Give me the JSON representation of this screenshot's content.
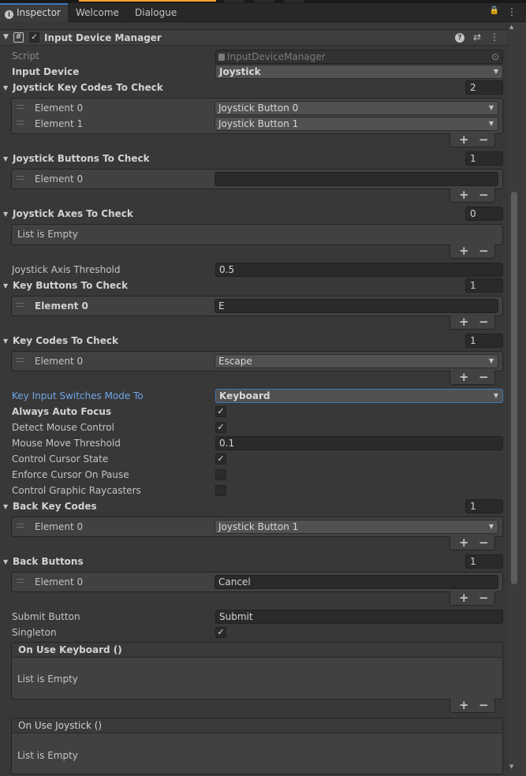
{
  "tabs": [
    {
      "label": "Inspector",
      "active": true,
      "icon": "info-icon"
    },
    {
      "label": "Welcome",
      "active": false
    },
    {
      "label": "Dialogue",
      "active": false
    }
  ],
  "component": {
    "title": "Input Device Manager",
    "enabled": true,
    "icons": [
      "help-icon",
      "preset-icon",
      "more-icon"
    ]
  },
  "script": {
    "label": "Script",
    "value": "InputDeviceManager"
  },
  "input_device": {
    "label": "Input Device",
    "value": "Joystick"
  },
  "joystick_key_codes": {
    "label": "Joystick Key Codes To Check",
    "count": "2",
    "elements": [
      {
        "label": "Element 0",
        "value": "Joystick Button 0"
      },
      {
        "label": "Element 1",
        "value": "Joystick Button 1"
      }
    ]
  },
  "joystick_buttons": {
    "label": "Joystick Buttons To Check",
    "count": "1",
    "elements": [
      {
        "label": "Element 0",
        "value": ""
      }
    ]
  },
  "joystick_axes": {
    "label": "Joystick Axes To Check",
    "count": "0",
    "empty_label": "List is Empty"
  },
  "joystick_axis_threshold": {
    "label": "Joystick Axis Threshold",
    "value": "0.5"
  },
  "key_buttons": {
    "label": "Key Buttons To Check",
    "count": "1",
    "elements": [
      {
        "label": "Element 0",
        "value": "E"
      }
    ]
  },
  "key_codes": {
    "label": "Key Codes To Check",
    "count": "1",
    "elements": [
      {
        "label": "Element 0",
        "value": "Escape"
      }
    ]
  },
  "key_input_switches": {
    "label": "Key Input Switches Mode To",
    "value": "Keyboard"
  },
  "always_auto_focus": {
    "label": "Always Auto Focus",
    "checked": true
  },
  "detect_mouse_control": {
    "label": "Detect Mouse Control",
    "checked": true
  },
  "mouse_move_threshold": {
    "label": "Mouse Move Threshold",
    "value": "0.1"
  },
  "control_cursor_state": {
    "label": "Control Cursor State",
    "checked": true
  },
  "enforce_cursor_on_pause": {
    "label": "Enforce Cursor On Pause",
    "checked": false
  },
  "control_graphic_raycasters": {
    "label": "Control Graphic Raycasters",
    "checked": false
  },
  "back_key_codes": {
    "label": "Back Key Codes",
    "count": "1",
    "elements": [
      {
        "label": "Element 0",
        "value": "Joystick Button 1"
      }
    ]
  },
  "back_buttons": {
    "label": "Back Buttons",
    "count": "1",
    "elements": [
      {
        "label": "Element 0",
        "value": "Cancel"
      }
    ]
  },
  "submit_button": {
    "label": "Submit Button",
    "value": "Submit"
  },
  "singleton": {
    "label": "Singleton",
    "checked": true
  },
  "on_use_keyboard": {
    "title": "On Use Keyboard ()",
    "empty_label": "List is Empty"
  },
  "on_use_joystick": {
    "title": "On Use Joystick ()",
    "empty_label": "List is Empty"
  },
  "glyphs": {
    "check": "✓",
    "plus": "+",
    "minus": "−",
    "caret_down": "▼",
    "fold_open": "▼",
    "lock": "🔒",
    "help": "?",
    "preset": "⇄",
    "more": "⋮",
    "hash": "#",
    "info": "i",
    "target": "⊙",
    "scroll_up": "▲",
    "scroll_down": "▼"
  },
  "colors": {
    "accent": "#3a79bb",
    "overridden_label": "#6fa5e6",
    "background": "#383838"
  }
}
